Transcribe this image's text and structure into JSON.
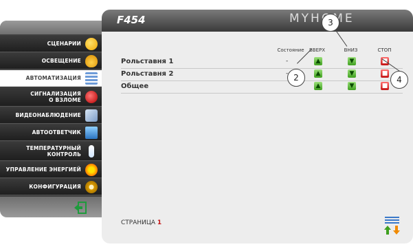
{
  "sidebar": {
    "items": [
      {
        "label": "СЦЕНАРИИ",
        "icon": "scenarios-icon",
        "active": false
      },
      {
        "label": "ОСВЕЩЕНИЕ",
        "icon": "lighting-icon",
        "active": false
      },
      {
        "label": "АВТОМАТИЗАЦИЯ",
        "icon": "automation-icon",
        "active": true
      },
      {
        "label": "СИГНАЛИЗАЦИЯ О ВЗЛОМЕ",
        "icon": "burglar-alarm-icon",
        "active": false
      },
      {
        "label": "ВИДЕОНАБЛЮДЕНИЕ",
        "icon": "video-surveillance-icon",
        "active": false
      },
      {
        "label": "АВТООТВЕТЧИК",
        "icon": "answering-machine-icon",
        "active": false
      },
      {
        "label": "ТЕМПЕРАТУРНЫЙ КОНТРОЛЬ",
        "icon": "thermometer-icon",
        "active": false
      },
      {
        "label": "УПРАВЛЕНИЕ ЭНЕРГИЕЙ",
        "icon": "energy-management-icon",
        "active": false
      },
      {
        "label": "КОНФИГУРАЦИЯ",
        "icon": "configuration-gear-icon",
        "active": false
      }
    ]
  },
  "header": {
    "title": "F454",
    "brand": "MYHOME"
  },
  "table": {
    "columns": [
      "Состояние",
      "ВВЕРХ",
      "ВНИЗ",
      "СТОП"
    ],
    "rows": [
      {
        "label": "Рольставня 1",
        "state": "-"
      },
      {
        "label": "Рольставня 2",
        "state": "-"
      },
      {
        "label": "Общее",
        "state": ""
      }
    ]
  },
  "footer": {
    "page_label": "СТРАНИЦА",
    "page_number": "1"
  },
  "callouts": [
    "2",
    "3",
    "4"
  ],
  "colors": {
    "up_down_button": "#3fa01f",
    "stop_button": "#c41515",
    "sidebar_bg": "#2a2a2a",
    "panel_bg": "#ededed"
  }
}
